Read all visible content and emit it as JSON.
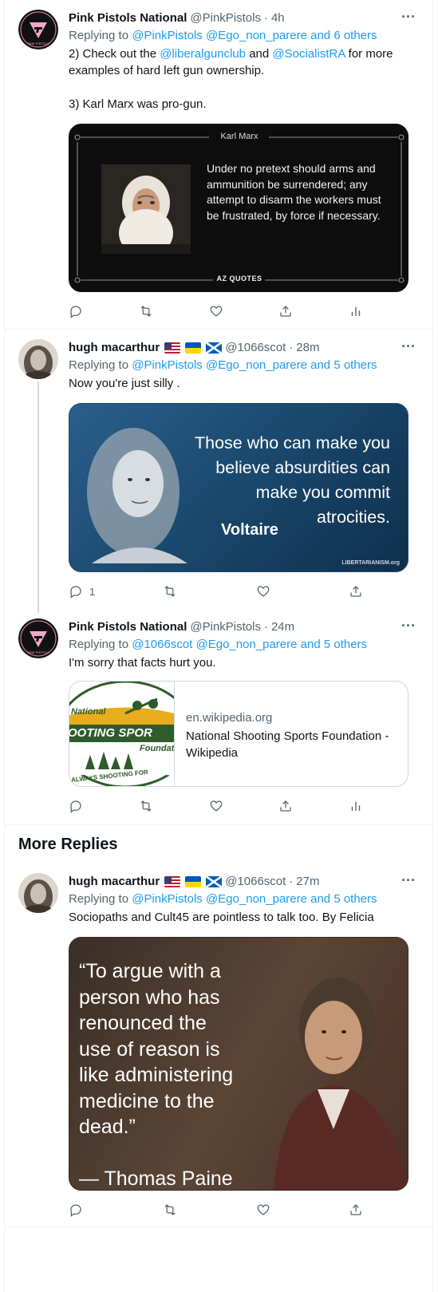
{
  "tweets": [
    {
      "name": "Pink Pistols National",
      "handle": "@PinkPistols",
      "time": "4h",
      "replying_prefix": "Replying to ",
      "replying_mentions": "@PinkPistols @Ego_non_parere and 6 others",
      "body_parts": {
        "p1_a": "2) Check out the ",
        "p1_link1": "@liberalgunclub",
        "p1_b": " and ",
        "p1_link2": "@SocialistRA",
        "p1_c": " for more examples of hard left gun ownership.",
        "p2": "3) Karl Marx was pro-gun."
      },
      "image": {
        "header": "Karl Marx",
        "quote": "Under no pretext should arms and ammunition be surrendered; any attempt to disarm the workers must be frustrated, by force if necessary.",
        "footer": "AZ QUOTES"
      }
    },
    {
      "name": "hugh macarthur",
      "handle": "@1066scot",
      "time": "28m",
      "replying_prefix": "Replying to ",
      "replying_mentions": "@PinkPistols @Ego_non_parere and 5 others",
      "body": "Now you're just silly .",
      "image": {
        "quote": "Those who can make you believe absurdities can make you commit atrocities.",
        "author": "Voltaire",
        "watermark": "LIBERTARIANISM.org"
      },
      "reply_count": "1"
    },
    {
      "name": "Pink Pistols National",
      "handle": "@PinkPistols",
      "time": "24m",
      "replying_prefix": "Replying to ",
      "replying_mentions": "@1066scot @Ego_non_parere and 5 others",
      "body": "I'm sorry that facts hurt you.",
      "card": {
        "domain": "en.wikipedia.org",
        "title": "National Shooting Sports Foundation - Wikipedia",
        "logo_top": "National",
        "logo_mid": "OOTING SPOR",
        "logo_low": "Foundatio",
        "logo_bottom": "ALWAYS SHOOTING FOR"
      }
    },
    {
      "name": "hugh macarthur",
      "handle": "@1066scot",
      "time": "27m",
      "replying_prefix": "Replying to ",
      "replying_mentions": "@PinkPistols @Ego_non_parere and 5 others",
      "body": "Sociopaths and Cult45 are pointless to talk too. By Felicia",
      "image": {
        "quote_lines": [
          "“To argue with a",
          "person who has",
          "renounced the",
          "use of reason is",
          "like administering",
          "medicine to the",
          "dead.”"
        ],
        "author": "— Thomas Paine"
      }
    }
  ],
  "more_replies_title": "More Replies",
  "avatar_pink_text": "PINK PISTOLS",
  "colors": {
    "accent": "#1d9bf0",
    "secondary": "#536471",
    "pink": "#f4a7c7"
  }
}
